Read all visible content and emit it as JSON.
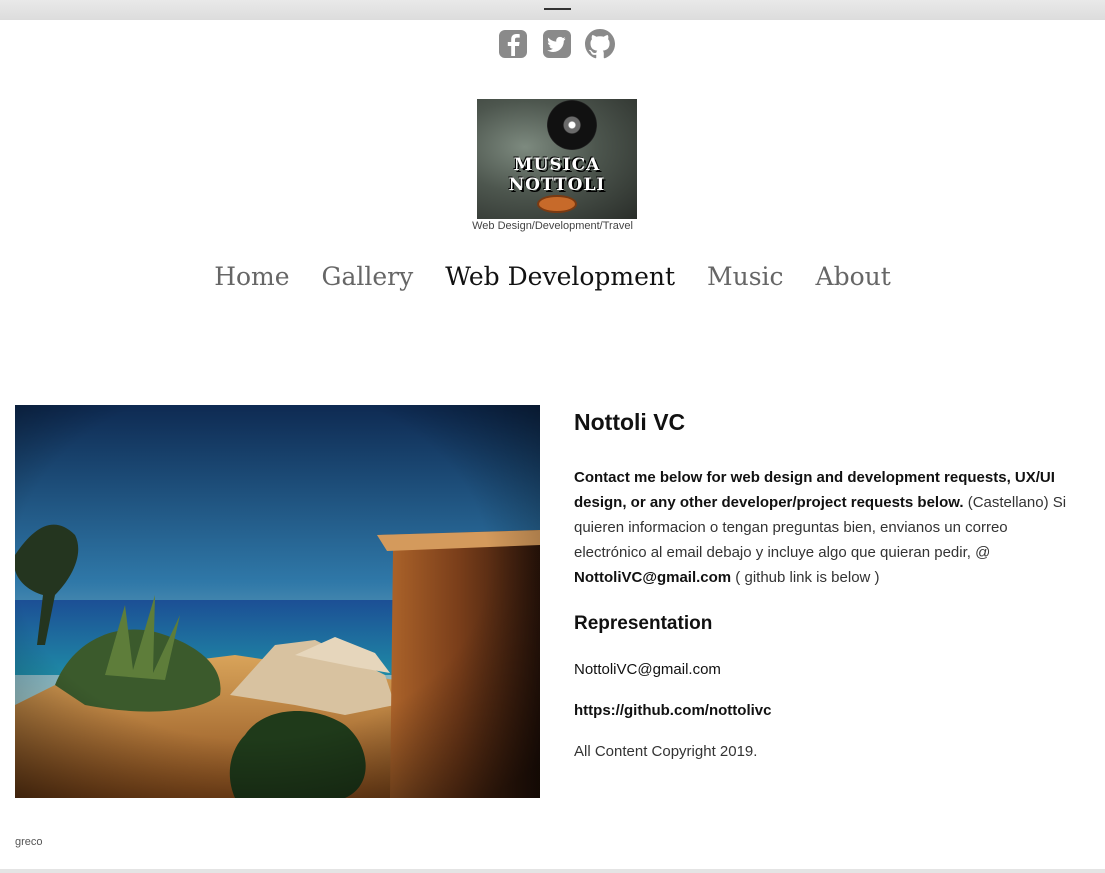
{
  "social": {
    "icons": [
      "facebook-icon",
      "twitter-icon",
      "github-icon"
    ],
    "color": "#8a8a8a"
  },
  "logo": {
    "line1": "MUSICA",
    "line2": "NOTTOLI"
  },
  "tagline": "Web Design/Development/Travel",
  "nav": {
    "items": [
      "Home",
      "Gallery",
      "Web Development",
      "Music",
      "About"
    ],
    "active": "Web Development"
  },
  "photo": {
    "caption": "greco"
  },
  "content": {
    "title": "Nottoli VC",
    "description_bold": "Contact me below for web design and development requests, UX/UI design, or any other developer/project requests below.",
    "description_rest": " (Castellano) Si quieren informacion o tengan preguntas bien, envianos un correo electrónico al email debajo y incluye algo que quieran pedir, @ ",
    "description_email": "NottoliVC@gmail.com",
    "description_tail": " ( github link is below )",
    "representation_heading": "Representation",
    "email": "NottoliVC@gmail.com",
    "github": "https://github.com/nottolivc",
    "copyright": "All Content Copyright 2019."
  }
}
